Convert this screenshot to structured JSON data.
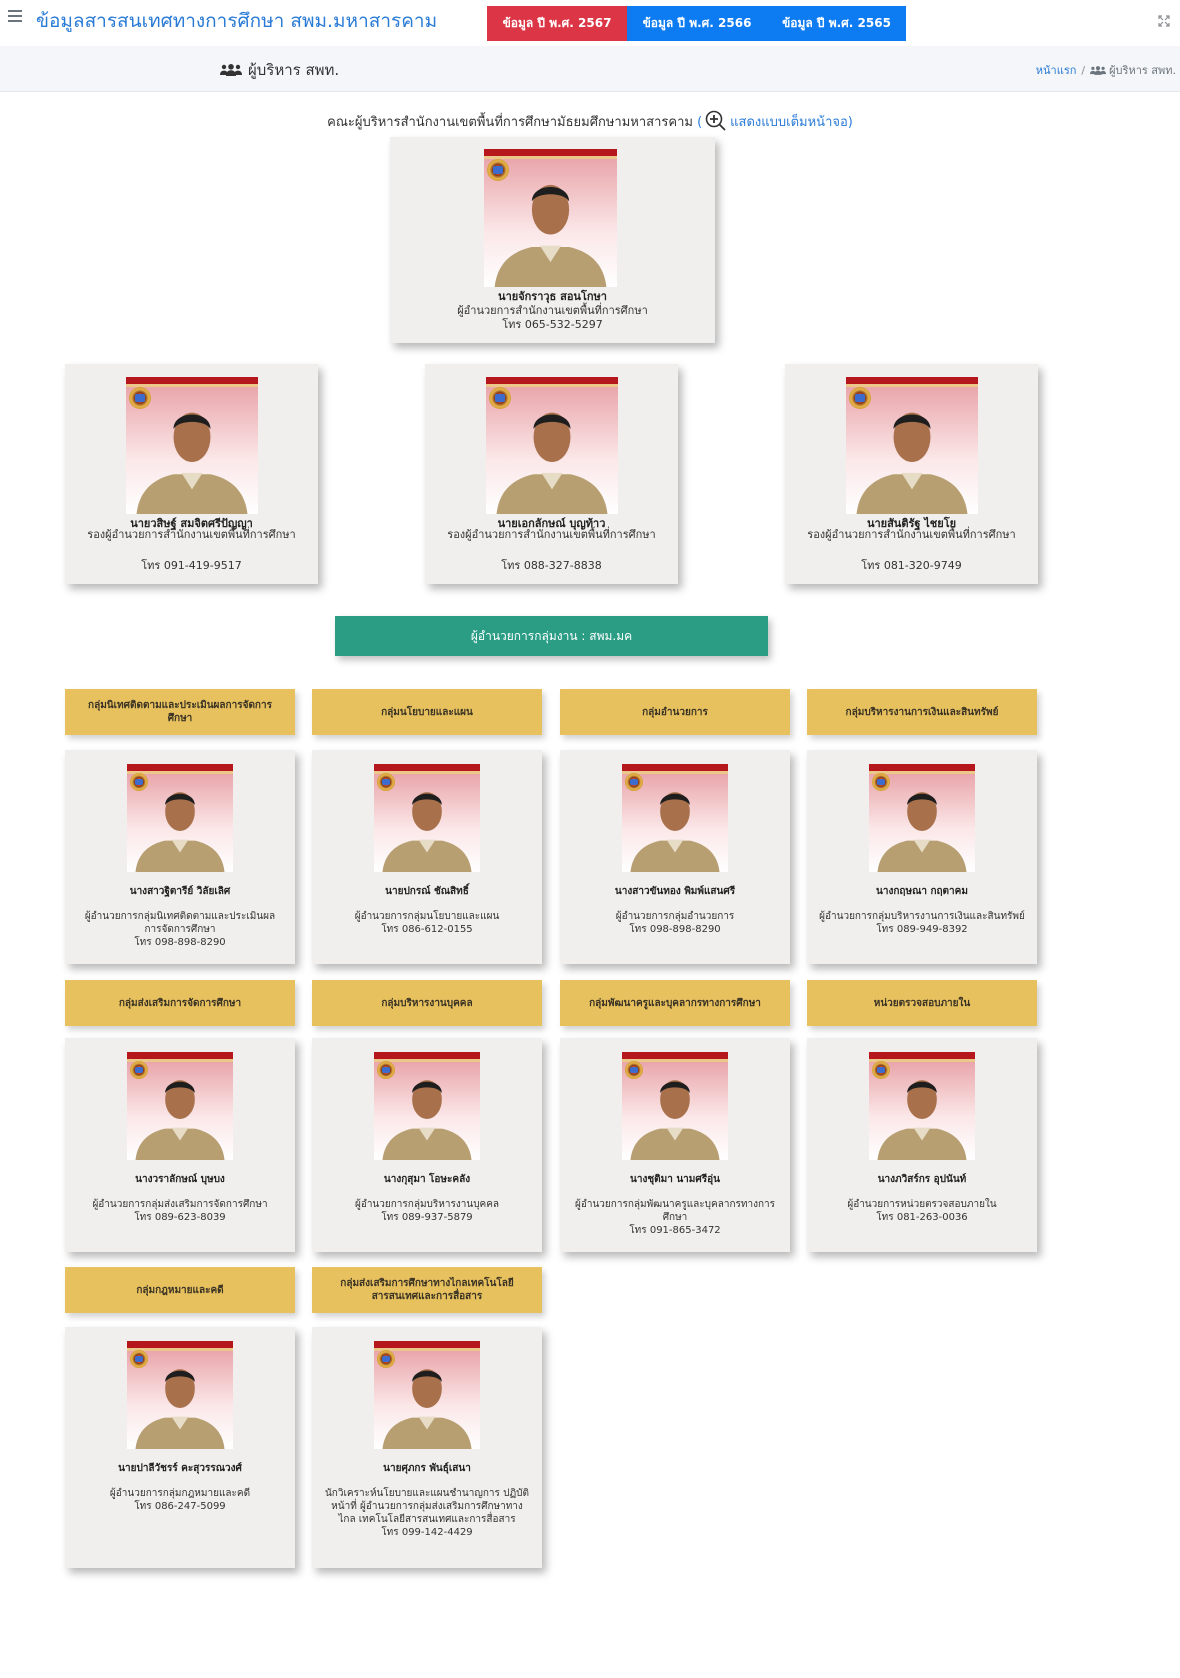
{
  "navbar": {
    "site_title": "ข้อมูลสารสนเทศทางการศึกษา สพม.มหาสารคาม",
    "year_buttons": [
      "ข้อมูล ปี พ.ศ. 2567",
      "ข้อมูล ปี พ.ศ. 2566",
      "ข้อมูล ปี พ.ศ. 2565"
    ]
  },
  "header": {
    "page_title": "ผู้บริหาร สพท.",
    "breadcrumb": {
      "home": "หน้าแรก",
      "separator": "/",
      "current": "ผู้บริหาร สพท."
    }
  },
  "org": {
    "heading_text": "คณะผู้บริหารสำนักงานเขตพื้นที่การศึกษามัธยมศึกษามหาสารคาม",
    "open_paren": "(",
    "fullscreen_link": "แสดงแบบเต็มหน้าจอ)"
  },
  "director": {
    "name": "นายจักราวุธ สอนโกษา",
    "title": "ผู้อำนวยการสำนักงานเขตพื้นที่การศึกษา",
    "phone": "โทร 065-532-5297"
  },
  "deputies": [
    {
      "name": "นายวสิษฐ์ สมจิตศรีปัญญา",
      "title": "รองผู้อำนวยการสำนักงานเขตพื้นที่การศึกษา",
      "phone": "โทร 091-419-9517"
    },
    {
      "name": "นายเอกลักษณ์ บุญท้าว",
      "title": "รองผู้อำนวยการสำนักงานเขตพื้นที่การศึกษา",
      "phone": "โทร 088-327-8838"
    },
    {
      "name": "นายสันติรัฐ ไชยโย",
      "title": "รองผู้อำนวยการสำนักงานเขตพื้นที่การศึกษา",
      "phone": "โทร 081-320-9749"
    }
  ],
  "group_banner": "ผู้อำนวยการกลุ่มงาน : สพม.มค",
  "divisions": [
    {
      "label": "กลุ่มนิเทศติดตามและประเมินผลการจัดการศึกษา",
      "name": "นางสาวฐิตารีย์ วิลัยเลิศ",
      "title": "ผู้อำนวยการกลุ่มนิเทศติดตามและประเมินผลการจัดการศึกษา",
      "phone": "โทร 098-898-8290"
    },
    {
      "label": "กลุ่มนโยบายและแผน",
      "name": "นายปกรณ์ ชัณสิทธิ์",
      "title": "ผู้อำนวยการกลุ่มนโยบายและแผน",
      "phone": "โทร 086-612-0155"
    },
    {
      "label": "กลุ่มอำนวยการ",
      "name": "นางสาวขันทอง พิมพ์แสนศรี",
      "title": "ผู้อำนวยการกลุ่มอำนวยการ",
      "phone": "โทร 098-898-8290"
    },
    {
      "label": "กลุ่มบริหารงานการเงินและสินทรัพย์",
      "name": "นางกฤษณา กฤตาคม",
      "title": "ผู้อำนวยการกลุ่มบริหารงานการเงินและสินทรัพย์",
      "phone": "โทร 089-949-8392"
    },
    {
      "label": "กลุ่มส่งเสริมการจัดการศึกษา",
      "name": "นางวราลักษณ์ บุษบง",
      "title": "ผู้อำนวยการกลุ่มส่งเสริมการจัดการศึกษา",
      "phone": "โทร 089-623-8039"
    },
    {
      "label": "กลุ่มบริหารงานบุคคล",
      "name": "นางกุสุมา โอษะคลัง",
      "title": "ผู้อำนวยการกลุ่มบริหารงานบุคคล",
      "phone": "โทร 089-937-5879"
    },
    {
      "label": "กลุ่มพัฒนาครูและบุคลากรทางการศึกษา",
      "name": "นางชุติมา นามศรีอุ่น",
      "title": "ผู้อำนวยการกลุ่มพัฒนาครูและบุคลากรทางการศึกษา",
      "phone": "โทร 091-865-3472"
    },
    {
      "label": "หน่วยตรวจสอบภายใน",
      "name": "นางภวิสร์กร อุปนันท์",
      "title": "ผู้อำนวยการหน่วยตรวจสอบภายใน",
      "phone": "โทร 081-263-0036"
    },
    {
      "label": "กลุ่มกฎหมายและคดี",
      "name": "นายปาลีวัชรร์ คะสุวรรณวงศ์",
      "title": "ผู้อำนวยการกลุ่มกฎหมายและคดี",
      "phone": "โทร 086-247-5099"
    },
    {
      "label": "กลุ่มส่งเสริมการศึกษาทางไกลเทคโนโลยีสารสนเทศและการสื่อสาร",
      "name": "นายศุภกร พันธุ์เสนา",
      "title": "นักวิเคราะห์นโยบายและแผนชำนาญการ ปฏิบัติหน้าที่ ผู้อำนวยการกลุ่มส่งเสริมการศึกษาทางไกล เทคโนโลยีสารสนเทศและการสื่อสาร",
      "phone": "โทร 099-142-4429"
    }
  ],
  "colors": {
    "link_blue": "#2a7bd6",
    "year_2567": "#dc3545",
    "year_other": "#0d7bf2",
    "teal_banner": "#2a9d84",
    "gold_label": "#e8c15f",
    "card_bg": "#f0efed"
  },
  "icons": [
    "hamburger-icon",
    "expand-icon",
    "users-icon",
    "zoom-in-icon",
    "school-emblem-icon"
  ]
}
